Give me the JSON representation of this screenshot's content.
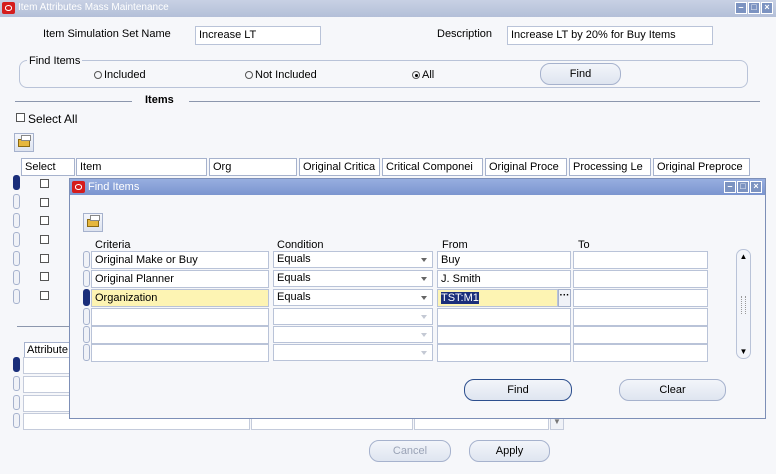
{
  "window": {
    "title": "Item Attributes Mass Maintenance"
  },
  "header": {
    "sim_set_label": "Item Simulation Set Name",
    "sim_set_value": "Increase LT",
    "description_label": "Description",
    "description_value": "Increase LT by 20% for Buy Items"
  },
  "find_items": {
    "label": "Find Items",
    "options": [
      "Included",
      "Not Included",
      "All"
    ],
    "selected": "All",
    "find_button": "Find"
  },
  "items_section": {
    "label": "Items",
    "select_all": "Select All",
    "columns": [
      "Select",
      "Item",
      "Org",
      "Original Critica",
      "Critical Componei",
      "Original Proce",
      "Processing Le",
      "Original Preproce"
    ]
  },
  "attributes_label": "Attribute",
  "footer": {
    "cancel": "Cancel",
    "apply": "Apply"
  },
  "dialog": {
    "title": "Find Items",
    "headers": {
      "criteria": "Criteria",
      "condition": "Condition",
      "from": "From",
      "to": "To"
    },
    "rows": [
      {
        "criteria": "Original Make or Buy",
        "condition": "Equals",
        "from": "Buy",
        "to": ""
      },
      {
        "criteria": "Original Planner",
        "condition": "Equals",
        "from": "J. Smith",
        "to": ""
      },
      {
        "criteria": "Organization",
        "condition": "Equals",
        "from": "TST:M1",
        "to": ""
      },
      {
        "criteria": "",
        "condition": "",
        "from": "",
        "to": ""
      },
      {
        "criteria": "",
        "condition": "",
        "from": "",
        "to": ""
      },
      {
        "criteria": "",
        "condition": "",
        "from": "",
        "to": ""
      }
    ],
    "find_button": "Find",
    "clear_button": "Clear"
  },
  "colors": {
    "title_bar": "#b3bfd8",
    "dialog_title_bar": "#7b95cf",
    "highlight": "#fdf4b3",
    "selection": "#1a2e7a"
  }
}
